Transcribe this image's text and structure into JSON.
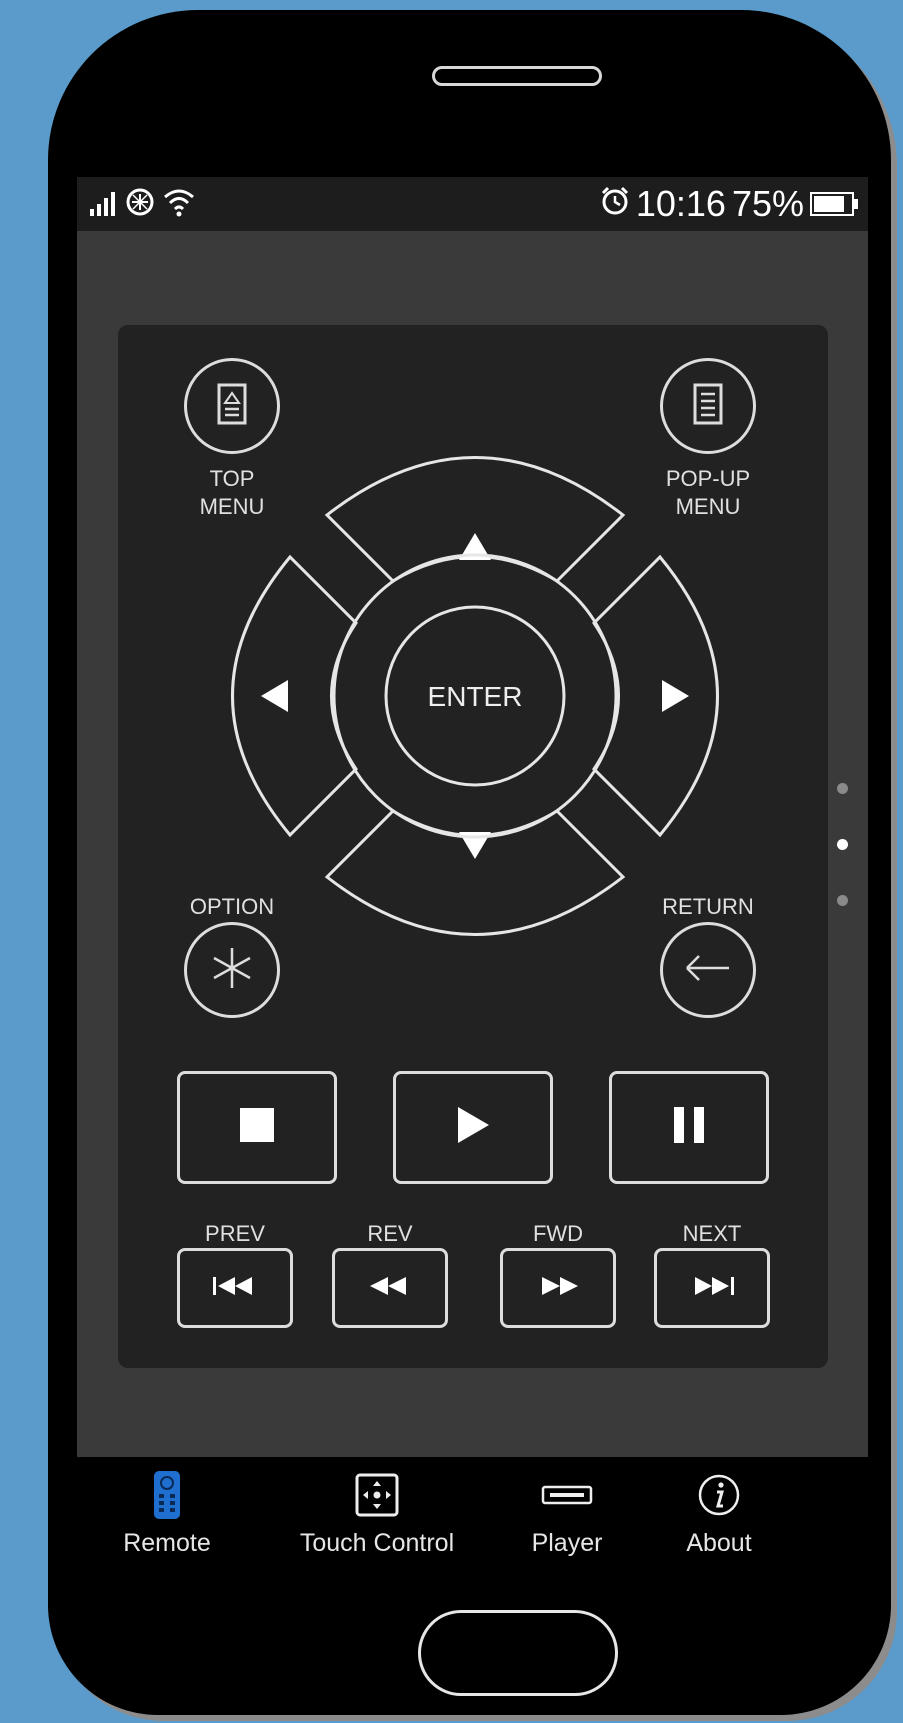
{
  "status_bar": {
    "time": "10:16",
    "battery": "75%",
    "icons": [
      "signal-icon",
      "sync-icon",
      "wifi-icon",
      "alarm-icon",
      "battery-icon"
    ]
  },
  "remote": {
    "top_menu_label_1": "TOP",
    "top_menu_label_2": "MENU",
    "popup_menu_label_1": "POP-UP",
    "popup_menu_label_2": "MENU",
    "enter_label": "ENTER",
    "option_label": "OPTION",
    "return_label": "RETURN",
    "prev_label": "PREV",
    "rev_label": "REV",
    "fwd_label": "FWD",
    "next_label": "NEXT"
  },
  "page_indicator": {
    "count": 3,
    "active_index": 1
  },
  "tabbar": {
    "tabs": [
      {
        "label": "Remote",
        "icon": "remote-icon",
        "active": true
      },
      {
        "label": "Touch Control",
        "icon": "touchpad-icon",
        "active": false
      },
      {
        "label": "Player",
        "icon": "player-icon",
        "active": false
      },
      {
        "label": "About",
        "icon": "info-icon",
        "active": false
      }
    ]
  },
  "colors": {
    "background": "#5a9bcb",
    "screen": "#3a3a3a",
    "panel": "#222222",
    "accent_tab": "#1f6fd1"
  }
}
